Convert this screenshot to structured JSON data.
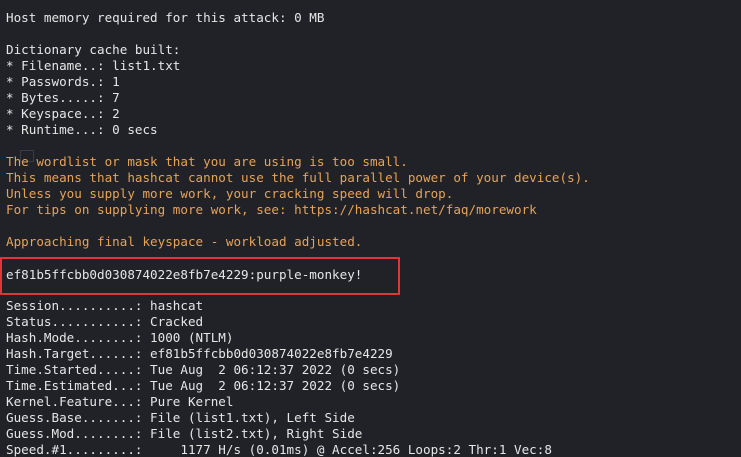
{
  "terminal": {
    "header_line": "Host memory required for this attack: 0 MB",
    "cache": {
      "title": "Dictionary cache built:",
      "items": [
        "* Filename..: list1.txt",
        "* Passwords.: 1",
        "* Bytes.....: 7",
        "* Keyspace..: 2",
        "* Runtime...: 0 secs"
      ]
    },
    "warning": {
      "lines": [
        "The wordlist or mask that you are using is too small.",
        "This means that hashcat cannot use the full parallel power of your device(s).",
        "Unless you supply more work, your cracking speed will drop.",
        "For tips on supplying more work, see: https://hashcat.net/faq/morework"
      ],
      "approach": "Approaching final keyspace - workload adjusted."
    },
    "result": "ef81b5ffcbb0d030874022e8fb7e4229:purple-monkey!",
    "status": [
      "Session..........: hashcat",
      "Status...........: Cracked",
      "Hash.Mode........: 1000 (NTLM)",
      "Hash.Target......: ef81b5ffcbb0d030874022e8fb7e4229",
      "Time.Started.....: Tue Aug  2 06:12:37 2022 (0 secs)",
      "Time.Estimated...: Tue Aug  2 06:12:37 2022 (0 secs)",
      "Kernel.Feature...: Pure Kernel",
      "Guess.Base.......: File (list1.txt), Left Side",
      "Guess.Mod........: File (list2.txt), Right Side",
      "Speed.#1.........:     1177 H/s (0.01ms) @ Accel:256 Loops:2 Thr:1 Vec:8"
    ],
    "colors": {
      "background": "#212227",
      "text": "#e6e6e6",
      "warning": "#e5a35a",
      "highlight_border": "#e0363a"
    }
  }
}
